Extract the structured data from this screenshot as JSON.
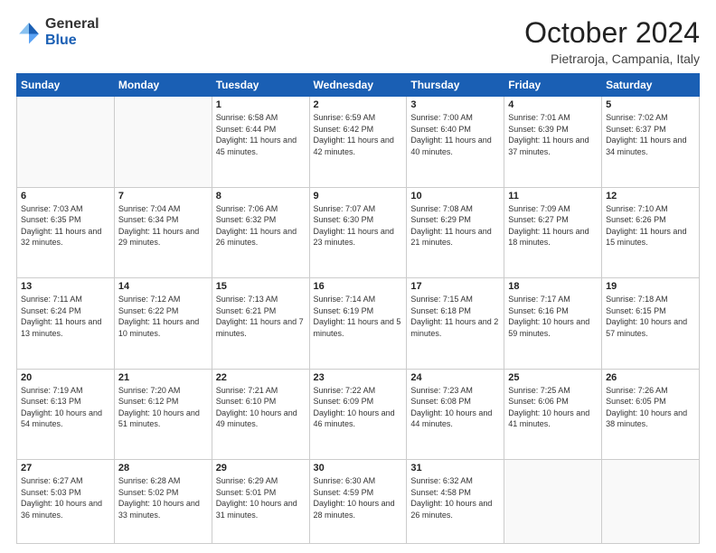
{
  "header": {
    "logo_general": "General",
    "logo_blue": "Blue",
    "month_title": "October 2024",
    "location": "Pietraroja, Campania, Italy"
  },
  "weekdays": [
    "Sunday",
    "Monday",
    "Tuesday",
    "Wednesday",
    "Thursday",
    "Friday",
    "Saturday"
  ],
  "weeks": [
    [
      {
        "day": "",
        "info": ""
      },
      {
        "day": "",
        "info": ""
      },
      {
        "day": "1",
        "info": "Sunrise: 6:58 AM\nSunset: 6:44 PM\nDaylight: 11 hours and 45 minutes."
      },
      {
        "day": "2",
        "info": "Sunrise: 6:59 AM\nSunset: 6:42 PM\nDaylight: 11 hours and 42 minutes."
      },
      {
        "day": "3",
        "info": "Sunrise: 7:00 AM\nSunset: 6:40 PM\nDaylight: 11 hours and 40 minutes."
      },
      {
        "day": "4",
        "info": "Sunrise: 7:01 AM\nSunset: 6:39 PM\nDaylight: 11 hours and 37 minutes."
      },
      {
        "day": "5",
        "info": "Sunrise: 7:02 AM\nSunset: 6:37 PM\nDaylight: 11 hours and 34 minutes."
      }
    ],
    [
      {
        "day": "6",
        "info": "Sunrise: 7:03 AM\nSunset: 6:35 PM\nDaylight: 11 hours and 32 minutes."
      },
      {
        "day": "7",
        "info": "Sunrise: 7:04 AM\nSunset: 6:34 PM\nDaylight: 11 hours and 29 minutes."
      },
      {
        "day": "8",
        "info": "Sunrise: 7:06 AM\nSunset: 6:32 PM\nDaylight: 11 hours and 26 minutes."
      },
      {
        "day": "9",
        "info": "Sunrise: 7:07 AM\nSunset: 6:30 PM\nDaylight: 11 hours and 23 minutes."
      },
      {
        "day": "10",
        "info": "Sunrise: 7:08 AM\nSunset: 6:29 PM\nDaylight: 11 hours and 21 minutes."
      },
      {
        "day": "11",
        "info": "Sunrise: 7:09 AM\nSunset: 6:27 PM\nDaylight: 11 hours and 18 minutes."
      },
      {
        "day": "12",
        "info": "Sunrise: 7:10 AM\nSunset: 6:26 PM\nDaylight: 11 hours and 15 minutes."
      }
    ],
    [
      {
        "day": "13",
        "info": "Sunrise: 7:11 AM\nSunset: 6:24 PM\nDaylight: 11 hours and 13 minutes."
      },
      {
        "day": "14",
        "info": "Sunrise: 7:12 AM\nSunset: 6:22 PM\nDaylight: 11 hours and 10 minutes."
      },
      {
        "day": "15",
        "info": "Sunrise: 7:13 AM\nSunset: 6:21 PM\nDaylight: 11 hours and 7 minutes."
      },
      {
        "day": "16",
        "info": "Sunrise: 7:14 AM\nSunset: 6:19 PM\nDaylight: 11 hours and 5 minutes."
      },
      {
        "day": "17",
        "info": "Sunrise: 7:15 AM\nSunset: 6:18 PM\nDaylight: 11 hours and 2 minutes."
      },
      {
        "day": "18",
        "info": "Sunrise: 7:17 AM\nSunset: 6:16 PM\nDaylight: 10 hours and 59 minutes."
      },
      {
        "day": "19",
        "info": "Sunrise: 7:18 AM\nSunset: 6:15 PM\nDaylight: 10 hours and 57 minutes."
      }
    ],
    [
      {
        "day": "20",
        "info": "Sunrise: 7:19 AM\nSunset: 6:13 PM\nDaylight: 10 hours and 54 minutes."
      },
      {
        "day": "21",
        "info": "Sunrise: 7:20 AM\nSunset: 6:12 PM\nDaylight: 10 hours and 51 minutes."
      },
      {
        "day": "22",
        "info": "Sunrise: 7:21 AM\nSunset: 6:10 PM\nDaylight: 10 hours and 49 minutes."
      },
      {
        "day": "23",
        "info": "Sunrise: 7:22 AM\nSunset: 6:09 PM\nDaylight: 10 hours and 46 minutes."
      },
      {
        "day": "24",
        "info": "Sunrise: 7:23 AM\nSunset: 6:08 PM\nDaylight: 10 hours and 44 minutes."
      },
      {
        "day": "25",
        "info": "Sunrise: 7:25 AM\nSunset: 6:06 PM\nDaylight: 10 hours and 41 minutes."
      },
      {
        "day": "26",
        "info": "Sunrise: 7:26 AM\nSunset: 6:05 PM\nDaylight: 10 hours and 38 minutes."
      }
    ],
    [
      {
        "day": "27",
        "info": "Sunrise: 6:27 AM\nSunset: 5:03 PM\nDaylight: 10 hours and 36 minutes."
      },
      {
        "day": "28",
        "info": "Sunrise: 6:28 AM\nSunset: 5:02 PM\nDaylight: 10 hours and 33 minutes."
      },
      {
        "day": "29",
        "info": "Sunrise: 6:29 AM\nSunset: 5:01 PM\nDaylight: 10 hours and 31 minutes."
      },
      {
        "day": "30",
        "info": "Sunrise: 6:30 AM\nSunset: 4:59 PM\nDaylight: 10 hours and 28 minutes."
      },
      {
        "day": "31",
        "info": "Sunrise: 6:32 AM\nSunset: 4:58 PM\nDaylight: 10 hours and 26 minutes."
      },
      {
        "day": "",
        "info": ""
      },
      {
        "day": "",
        "info": ""
      }
    ]
  ]
}
